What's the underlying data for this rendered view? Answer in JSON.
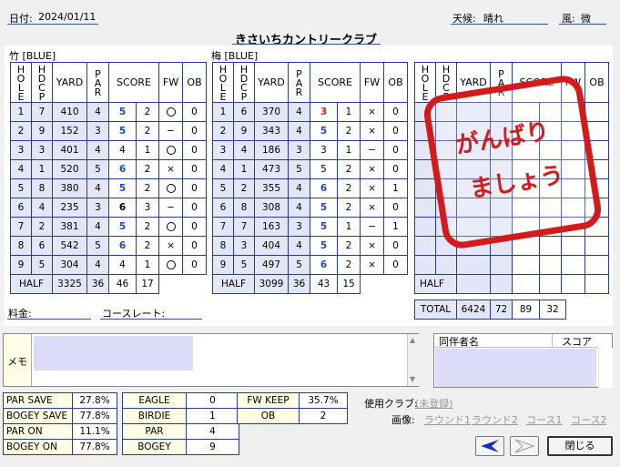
{
  "header": {
    "date_label": "日付:",
    "date": "2024/01/11",
    "course_name": "きさいちカントリークラブ",
    "weather_label": "天候:",
    "weather": "晴れ",
    "wind_label": "風:",
    "wind": "微"
  },
  "columns": {
    "hole": "HOLE",
    "hdcp": "HDCP",
    "yard": "YARD",
    "par": "PAR",
    "score": "SCORE",
    "fw": "FW",
    "ob": "OB"
  },
  "course_out": {
    "title": "竹 [BLUE]",
    "rows": [
      {
        "hole": "1",
        "hdcp": "7",
        "yard": "410",
        "par": "4",
        "score": "5",
        "color": "blue",
        "putts": "2",
        "fw": "○",
        "ob": "0"
      },
      {
        "hole": "2",
        "hdcp": "9",
        "yard": "152",
        "par": "3",
        "score": "5",
        "color": "blue",
        "putts": "2",
        "fw": "−",
        "ob": "0"
      },
      {
        "hole": "3",
        "hdcp": "3",
        "yard": "401",
        "par": "4",
        "score": "4",
        "color": "black",
        "putts": "1",
        "fw": "○",
        "ob": "0"
      },
      {
        "hole": "4",
        "hdcp": "1",
        "yard": "520",
        "par": "5",
        "score": "6",
        "color": "blue",
        "putts": "2",
        "fw": "×",
        "ob": "0"
      },
      {
        "hole": "5",
        "hdcp": "8",
        "yard": "380",
        "par": "4",
        "score": "5",
        "color": "blue",
        "putts": "2",
        "fw": "○",
        "ob": "0"
      },
      {
        "hole": "6",
        "hdcp": "4",
        "yard": "235",
        "par": "3",
        "score": "6",
        "color": "boldblack",
        "putts": "3",
        "fw": "−",
        "ob": "0"
      },
      {
        "hole": "7",
        "hdcp": "2",
        "yard": "381",
        "par": "4",
        "score": "5",
        "color": "blue",
        "putts": "2",
        "fw": "○",
        "ob": "0"
      },
      {
        "hole": "8",
        "hdcp": "6",
        "yard": "542",
        "par": "5",
        "score": "6",
        "color": "blue",
        "putts": "2",
        "fw": "×",
        "ob": "0"
      },
      {
        "hole": "9",
        "hdcp": "5",
        "yard": "304",
        "par": "4",
        "score": "4",
        "color": "black",
        "putts": "1",
        "fw": "○",
        "ob": "0"
      }
    ],
    "half": {
      "label": "HALF",
      "yard": "3325",
      "par": "36",
      "score": "46",
      "putts": "17"
    }
  },
  "course_in": {
    "title": "梅 [BLUE]",
    "rows": [
      {
        "hole": "1",
        "hdcp": "6",
        "yard": "370",
        "par": "4",
        "score": "3",
        "color": "red",
        "putts": "1",
        "fw": "×",
        "ob": "0"
      },
      {
        "hole": "2",
        "hdcp": "9",
        "yard": "343",
        "par": "4",
        "score": "5",
        "color": "blue",
        "putts": "2",
        "fw": "×",
        "ob": "0"
      },
      {
        "hole": "3",
        "hdcp": "4",
        "yard": "186",
        "par": "3",
        "score": "3",
        "color": "black",
        "putts": "1",
        "fw": "−",
        "ob": "0"
      },
      {
        "hole": "4",
        "hdcp": "1",
        "yard": "473",
        "par": "5",
        "score": "5",
        "color": "black",
        "putts": "2",
        "fw": "×",
        "ob": "0"
      },
      {
        "hole": "5",
        "hdcp": "2",
        "yard": "355",
        "par": "4",
        "score": "6",
        "color": "blue",
        "putts": "2",
        "fw": "×",
        "ob": "1"
      },
      {
        "hole": "6",
        "hdcp": "8",
        "yard": "308",
        "par": "4",
        "score": "5",
        "color": "blue",
        "putts": "2",
        "fw": "×",
        "ob": "0"
      },
      {
        "hole": "7",
        "hdcp": "7",
        "yard": "163",
        "par": "3",
        "score": "5",
        "color": "blue",
        "putts": "1",
        "fw": "−",
        "ob": "1"
      },
      {
        "hole": "8",
        "hdcp": "3",
        "yard": "404",
        "par": "4",
        "score": "5",
        "color": "blue",
        "putts": "2",
        "fw": "×",
        "ob": "0"
      },
      {
        "hole": "9",
        "hdcp": "5",
        "yard": "497",
        "par": "5",
        "score": "6",
        "color": "blue",
        "putts": "2",
        "fw": "×",
        "ob": "0"
      }
    ],
    "half": {
      "label": "HALF",
      "yard": "3099",
      "par": "36",
      "score": "43",
      "putts": "15"
    }
  },
  "course_third": {
    "half_label": "HALF",
    "stamp_line1": "がんばり",
    "stamp_line2": "ましょう",
    "total": {
      "label": "TOTAL",
      "yard": "6424",
      "par": "72",
      "score": "89",
      "putts": "32"
    }
  },
  "fees": {
    "fee_label": "料金:",
    "rating_label": "コースレート:"
  },
  "memo": {
    "label": "メモ"
  },
  "companions": {
    "name_col": "同伴者名",
    "score_col": "スコア"
  },
  "stats_left": [
    {
      "label": "PAR SAVE",
      "value": "27.8%"
    },
    {
      "label": "BOGEY SAVE",
      "value": "77.8%"
    },
    {
      "label": "PAR ON",
      "value": "11.1%"
    },
    {
      "label": "BOGEY ON",
      "value": "77.8%"
    }
  ],
  "stats_mid": [
    {
      "label": "EAGLE",
      "value": "0"
    },
    {
      "label": "BIRDIE",
      "value": "1"
    },
    {
      "label": "PAR",
      "value": "4"
    },
    {
      "label": "BOGEY",
      "value": "9"
    }
  ],
  "stats_right": [
    {
      "label": "FW KEEP",
      "value": "35.7%"
    },
    {
      "label": "OB",
      "value": "2"
    }
  ],
  "clubs": {
    "label": "使用クラブ:",
    "link": "(未登録)"
  },
  "images": {
    "label": "画像:",
    "links": [
      "ラウンド1",
      "ラウンド2",
      "コース1",
      "コース2"
    ]
  },
  "buttons": {
    "close": "閉じる"
  },
  "colors": {
    "score_blue": "#1e46c8",
    "score_red": "#e0201c",
    "stamp_red": "#d41b1b",
    "grid_line": "#2b3c8f",
    "shade": "#e3e6f7"
  }
}
